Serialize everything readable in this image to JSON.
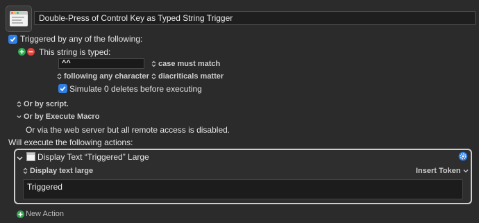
{
  "macro": {
    "name": "Double-Press of Control Key as Typed String Trigger"
  },
  "trigger": {
    "header_label": "Triggered by any of the following:",
    "string_trigger_label": "This string is typed:",
    "typed_string": "^^",
    "case_option": "case must match",
    "following_option": "following any character",
    "diacriticals_option": "diacriticals matter",
    "simulate_label": "Simulate 0 deletes before executing",
    "or_by_script": "Or by script.",
    "or_by_execute_macro": "Or by Execute Macro",
    "web_server_note": "Or via the web server but all remote access is disabled."
  },
  "actions": {
    "header_label": "Will execute the following actions:",
    "items": [
      {
        "title": "Display Text “Triggered” Large",
        "mode": "Display text large",
        "insert_token_label": "Insert Token",
        "text": "Triggered"
      }
    ],
    "new_action_label": "New Action"
  },
  "colors": {
    "accent": "#2f7fe8",
    "plus": "#2fa84f",
    "minus": "#e2443c",
    "background": "#2b2b2b"
  }
}
